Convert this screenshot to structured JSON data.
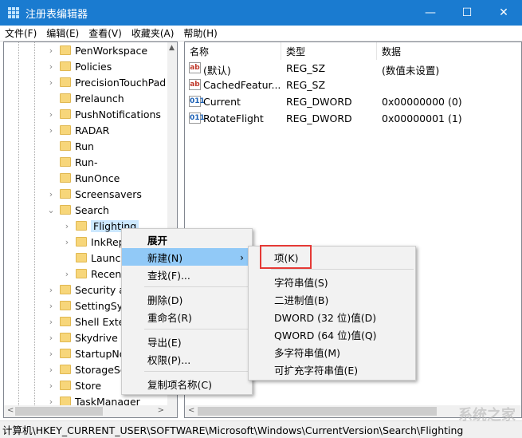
{
  "window": {
    "title": "注册表编辑器",
    "minimize": "—",
    "maximize": "☐",
    "close": "✕"
  },
  "menubar": [
    "文件(F)",
    "编辑(E)",
    "查看(V)",
    "收藏夹(A)",
    "帮助(H)"
  ],
  "tree": [
    {
      "label": "PenWorkspace",
      "level": 0,
      "expand": "›"
    },
    {
      "label": "Policies",
      "level": 0,
      "expand": "›"
    },
    {
      "label": "PrecisionTouchPad",
      "level": 0,
      "expand": "›"
    },
    {
      "label": "Prelaunch",
      "level": 0,
      "expand": ""
    },
    {
      "label": "PushNotifications",
      "level": 0,
      "expand": "›"
    },
    {
      "label": "RADAR",
      "level": 0,
      "expand": "›"
    },
    {
      "label": "Run",
      "level": 0,
      "expand": ""
    },
    {
      "label": "Run-",
      "level": 0,
      "expand": ""
    },
    {
      "label": "RunOnce",
      "level": 0,
      "expand": ""
    },
    {
      "label": "Screensavers",
      "level": 0,
      "expand": "›"
    },
    {
      "label": "Search",
      "level": 0,
      "expand": "⌄"
    },
    {
      "label": "Flighting",
      "level": 1,
      "expand": "›",
      "selected": true
    },
    {
      "label": "InkRep",
      "level": 1,
      "expand": "›"
    },
    {
      "label": "Launch",
      "level": 1,
      "expand": ""
    },
    {
      "label": "Recent",
      "level": 1,
      "expand": "›"
    },
    {
      "label": "Security a",
      "level": 0,
      "expand": "›"
    },
    {
      "label": "SettingSyn",
      "level": 0,
      "expand": "›"
    },
    {
      "label": "Shell Exte",
      "level": 0,
      "expand": "›"
    },
    {
      "label": "Skydrive",
      "level": 0,
      "expand": "›"
    },
    {
      "label": "StartupNo",
      "level": 0,
      "expand": "›"
    },
    {
      "label": "StorageSe",
      "level": 0,
      "expand": "›"
    },
    {
      "label": "Store",
      "level": 0,
      "expand": "›"
    },
    {
      "label": "TaskManager",
      "level": 0,
      "expand": "›"
    }
  ],
  "list": {
    "headers": [
      "名称",
      "类型",
      "数据"
    ],
    "rows": [
      {
        "icon": "string",
        "name": "(默认)",
        "type": "REG_SZ",
        "data": "(数值未设置)"
      },
      {
        "icon": "string",
        "name": "CachedFeatur...",
        "type": "REG_SZ",
        "data": ""
      },
      {
        "icon": "binary",
        "name": "Current",
        "type": "REG_DWORD",
        "data": "0x00000000 (0)"
      },
      {
        "icon": "binary",
        "name": "RotateFlight",
        "type": "REG_DWORD",
        "data": "0x00000001 (1)"
      }
    ]
  },
  "context_menu": {
    "expand": "展开",
    "new": "新建(N)",
    "find": "查找(F)...",
    "delete": "删除(D)",
    "rename": "重命名(R)",
    "export": "导出(E)",
    "permissions": "权限(P)...",
    "copy_name": "复制项名称(C)"
  },
  "submenu": {
    "key": "项(K)",
    "string": "字符串值(S)",
    "binary": "二进制值(B)",
    "dword": "DWORD (32 位)值(D)",
    "qword": "QWORD (64 位)值(Q)",
    "multi": "多字符串值(M)",
    "expandable": "可扩充字符串值(E)"
  },
  "status": "计算机\\HKEY_CURRENT_USER\\SOFTWARE\\Microsoft\\Windows\\CurrentVersion\\Search\\Flighting",
  "watermark": "系统之家",
  "accent": "#1a7bd0"
}
